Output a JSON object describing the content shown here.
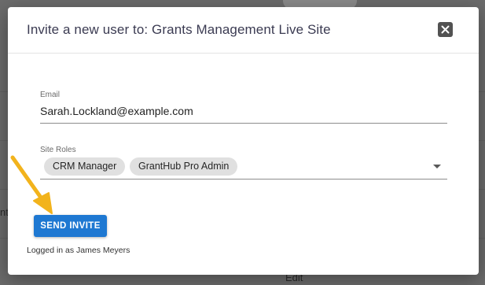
{
  "background": {
    "partial_row_text": "nt.",
    "edit_link": "Edit"
  },
  "dialog": {
    "title": "Invite a new user to: Grants Management Live Site",
    "close_icon": "close-icon",
    "email": {
      "label": "Email",
      "value": "Sarah.Lockland@example.com"
    },
    "site_roles": {
      "label": "Site Roles",
      "chips": [
        "CRM Manager",
        "GrantHub Pro Admin"
      ],
      "dropdown_icon": "dropdown-arrow-icon"
    },
    "send_invite_label": "SEND INVITE",
    "footer_text": "Logged in as James Meyers"
  },
  "colors": {
    "primary_button": "#1e78d2",
    "annotation_arrow": "#f2b31c",
    "overlay": "#6b6b6b"
  }
}
